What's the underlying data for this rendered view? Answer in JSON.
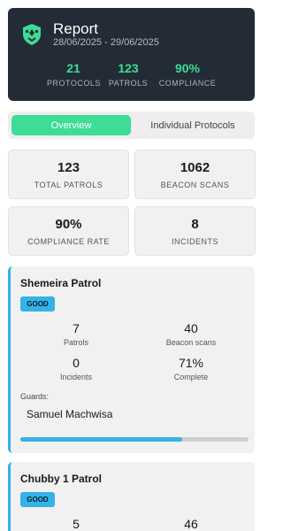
{
  "header": {
    "title": "Report",
    "date_range": "28/06/2025 - 29/06/2025",
    "logo_icon": "shield-icon",
    "stats": [
      {
        "value": "21",
        "label": "PROTOCOLS"
      },
      {
        "value": "123",
        "label": "PATROLS"
      },
      {
        "value": "90%",
        "label": "COMPLIANCE"
      }
    ]
  },
  "tabs": {
    "overview": "Overview",
    "individual": "Individual Protocols",
    "active": "overview"
  },
  "summary": [
    {
      "value": "123",
      "label": "TOTAL PATROLS"
    },
    {
      "value": "1062",
      "label": "BEACON SCANS"
    },
    {
      "value": "90%",
      "label": "COMPLIANCE RATE"
    },
    {
      "value": "8",
      "label": "INCIDENTS"
    }
  ],
  "patrols": [
    {
      "name": "Shemeira Patrol",
      "status": "GOOD",
      "patrols": {
        "value": "7",
        "label": "Patrols"
      },
      "beacon_scans": {
        "value": "40",
        "label": "Beacon scans"
      },
      "incidents": {
        "value": "0",
        "label": "Incidents"
      },
      "complete": {
        "value": "71%",
        "label": "Complete"
      },
      "guards_label": "Guards:",
      "guard": "Samuel Machwisa",
      "progress": 0.71
    },
    {
      "name": "Chubby 1 Patrol",
      "status": "GOOD",
      "patrols": {
        "value": "5"
      },
      "beacon_scans": {
        "value": "46"
      }
    }
  ],
  "colors": {
    "accent_green": "#3ddc97",
    "accent_blue": "#35b2e8",
    "header_bg": "#222b36"
  }
}
